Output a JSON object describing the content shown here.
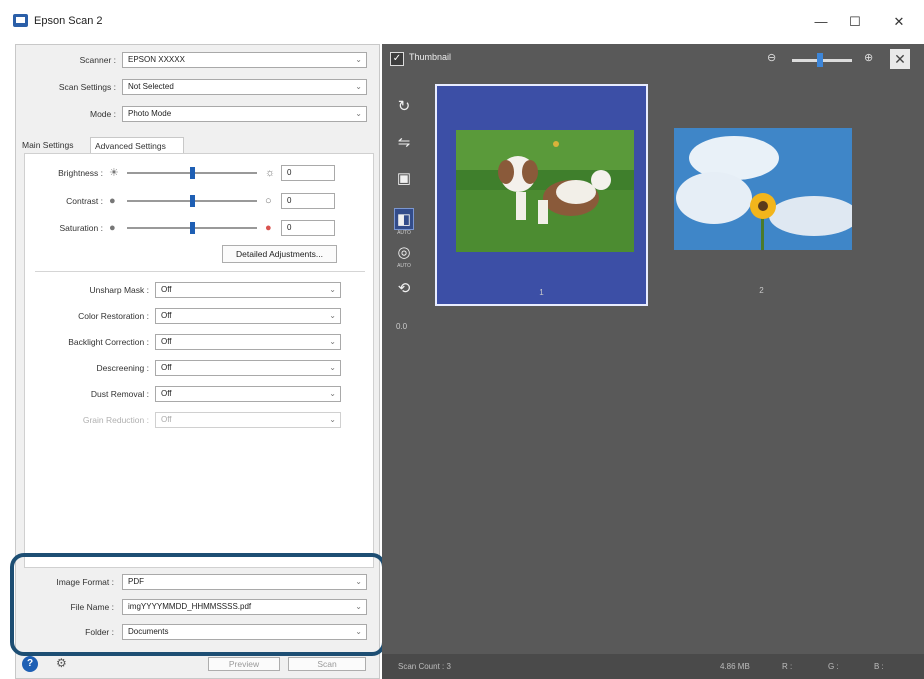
{
  "window": {
    "title": "Epson Scan 2",
    "minimize": "—",
    "maximize": "☐",
    "close": "✕"
  },
  "settings": {
    "scanner_label": "Scanner :",
    "scanner_value": "EPSON XXXXX",
    "scan_settings_label": "Scan Settings :",
    "scan_settings_value": "Not Selected",
    "mode_label": "Mode :",
    "mode_value": "Photo Mode"
  },
  "tabs": [
    {
      "label": "Main Settings",
      "active": false
    },
    {
      "label": "Advanced Settings",
      "active": true
    }
  ],
  "adjustments": [
    {
      "label": "Brightness :",
      "value": "0",
      "level": 0.5
    },
    {
      "label": "Contrast :",
      "value": "0",
      "level": 0.5
    },
    {
      "label": "Saturation :",
      "value": "0",
      "level": 0.5
    }
  ],
  "detailed_button": "Detailed Adjustments...",
  "options": [
    {
      "label": "Unsharp Mask :",
      "value": "Off",
      "enabled": true
    },
    {
      "label": "Color Restoration :",
      "value": "Off",
      "enabled": true
    },
    {
      "label": "Backlight Correction :",
      "value": "Off",
      "enabled": true
    },
    {
      "label": "Descreening :",
      "value": "Off",
      "enabled": true
    },
    {
      "label": "Dust Removal :",
      "value": "Off",
      "enabled": true
    },
    {
      "label": "Grain Reduction :",
      "value": "Off",
      "enabled": false
    }
  ],
  "output": {
    "image_format_label": "Image Format :",
    "image_format_value": "PDF",
    "file_name_label": "File Name :",
    "file_name_value": "imgYYYYMMDD_HHMMSSSS.pdf",
    "folder_label": "Folder :",
    "folder_value": "Documents"
  },
  "bottom": {
    "preview_button": "Preview",
    "scan_button": "Scan"
  },
  "thumbnail_panel": {
    "checkbox_label": "Thumbnail",
    "checked": true,
    "zoom_value": "0.0",
    "items": [
      {
        "number": "1",
        "selected": true,
        "subject": "dog on grass"
      },
      {
        "number": "2",
        "selected": false,
        "subject": "sunflower against sky"
      }
    ],
    "status": {
      "scan_count": "Scan Count : 3",
      "size": "4.86 MB",
      "r": "R :",
      "g": "G :",
      "b": "B :"
    }
  },
  "colors": {
    "accent": "#1e5fb4",
    "selection": "#3c4fa6",
    "highlight_border": "#1d4e73",
    "preview_bg": "#595959"
  }
}
